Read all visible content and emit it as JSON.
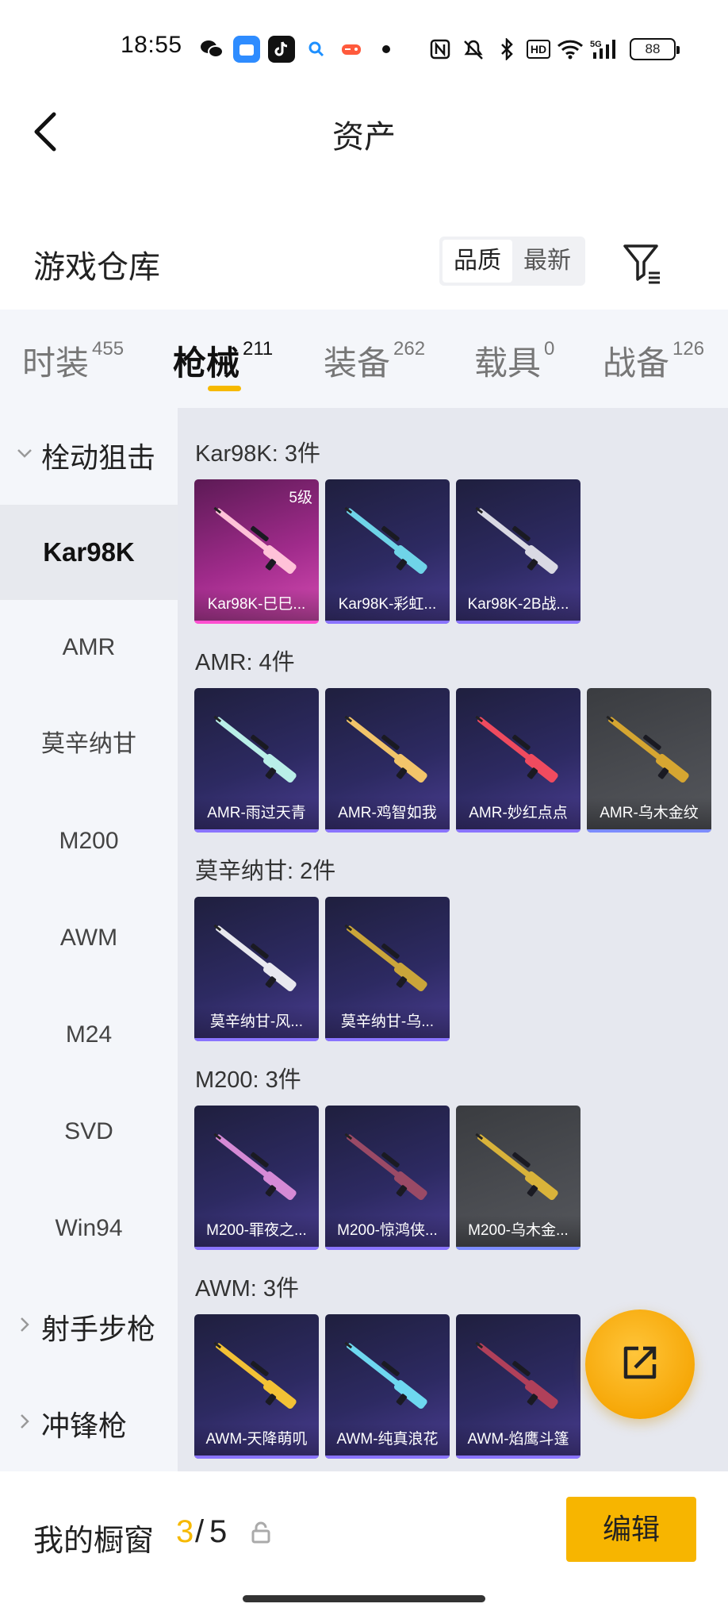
{
  "status_bar": {
    "time": "18:55",
    "icons": [
      "wechat-icon",
      "app-icon",
      "tiktok-icon",
      "search-app-icon",
      "game-icon",
      "dot-icon"
    ],
    "system_icons": [
      "nfc-icon",
      "mute-icon",
      "bluetooth-icon",
      "hd-icon",
      "wifi-icon",
      "signal-5g-icon"
    ],
    "hd_label": "HD",
    "battery": "88"
  },
  "header": {
    "title": "资产",
    "back_icon": "back-arrow-icon"
  },
  "section": {
    "title": "游戏仓库",
    "sort_options": [
      "品质",
      "最新"
    ],
    "active_sort": "品质",
    "filter_icon": "filter-icon"
  },
  "tabs": [
    {
      "label": "时装",
      "count": "455"
    },
    {
      "label": "枪械",
      "count": "211",
      "active": true
    },
    {
      "label": "装备",
      "count": "262"
    },
    {
      "label": "载具",
      "count": "0"
    },
    {
      "label": "战备",
      "count": "126"
    }
  ],
  "sidebar": {
    "groups": [
      {
        "label": "栓动狙击",
        "expanded": true
      },
      {
        "label": "射手步枪",
        "expanded": false
      },
      {
        "label": "冲锋枪",
        "expanded": false
      }
    ],
    "items": [
      "Kar98K",
      "AMR",
      "莫辛纳甘",
      "M200",
      "AWM",
      "M24",
      "SVD",
      "Win94"
    ],
    "active_item": "Kar98K"
  },
  "groups": [
    {
      "title": "Kar98K: 3件",
      "items": [
        {
          "name": "Kar98K-巳巳...",
          "level": "5级",
          "rarity": "legendary",
          "gun_color": "#ffc2d8"
        },
        {
          "name": "Kar98K-彩虹...",
          "rarity": "epic",
          "gun_color": "#6fd4e8"
        },
        {
          "name": "Kar98K-2B战...",
          "rarity": "epic",
          "gun_color": "#d9d9e3"
        }
      ]
    },
    {
      "title": "AMR: 4件",
      "items": [
        {
          "name": "AMR-雨过天青",
          "rarity": "epic",
          "gun_color": "#b9efe8"
        },
        {
          "name": "AMR-鸡智如我",
          "rarity": "epic",
          "gun_color": "#f2c46a"
        },
        {
          "name": "AMR-妙红点点",
          "rarity": "epic",
          "gun_color": "#ef4b5f"
        },
        {
          "name": "AMR-乌木金纹",
          "rarity": "rare",
          "gun_color": "#d6a631"
        }
      ]
    },
    {
      "title": "莫辛纳甘: 2件",
      "items": [
        {
          "name": "莫辛纳甘-风...",
          "rarity": "epic",
          "gun_color": "#e8e8ef"
        },
        {
          "name": "莫辛纳甘-乌...",
          "rarity": "epic",
          "gun_color": "#caa53a"
        }
      ]
    },
    {
      "title": "M200: 3件",
      "items": [
        {
          "name": "M200-罪夜之...",
          "rarity": "epic",
          "gun_color": "#d58ad6"
        },
        {
          "name": "M200-惊鸿侠...",
          "rarity": "epic",
          "gun_color": "#9a4a66"
        },
        {
          "name": "M200-乌木金...",
          "rarity": "rare",
          "gun_color": "#d9b33a"
        }
      ]
    },
    {
      "title": "AWM: 3件",
      "items": [
        {
          "name": "AWM-天降萌叽",
          "rarity": "epic",
          "gun_color": "#f2c135"
        },
        {
          "name": "AWM-纯真浪花",
          "rarity": "epic",
          "gun_color": "#6ed8f0"
        },
        {
          "name": "AWM-焰鹰斗篷",
          "rarity": "epic",
          "gun_color": "#b0405a"
        }
      ]
    }
  ],
  "fab": {
    "icon": "share-export-icon"
  },
  "bottom_bar": {
    "label": "我的橱窗",
    "used": "3",
    "slash": "/",
    "total": "5",
    "lock_icon": "lock-icon",
    "edit_label": "编辑"
  },
  "colors": {
    "accent": "#f6b900",
    "legendary": "#d64cb3",
    "epic": "#4a3d92",
    "rare": "#4b4d52"
  }
}
